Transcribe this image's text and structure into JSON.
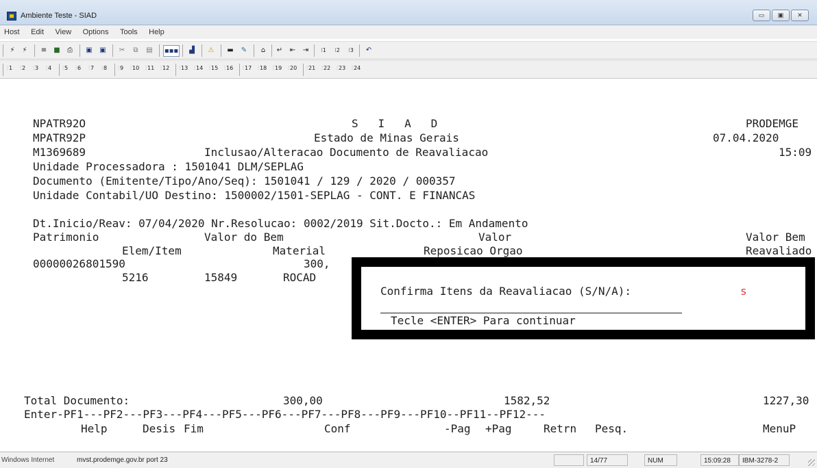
{
  "window": {
    "title": "Ambiente Teste - SIAD",
    "buttons": [
      "▭",
      "▣",
      "✕"
    ]
  },
  "menu": [
    "Host",
    "Edit",
    "View",
    "Options",
    "Tools",
    "Help"
  ],
  "pf_keys": [
    "1",
    "2",
    "3",
    "4",
    "5",
    "6",
    "7",
    "8",
    "9",
    "10",
    "11",
    "12",
    "13",
    "14",
    "15",
    "16",
    "17",
    "18",
    "19",
    "20",
    "21",
    "22",
    "23",
    "24"
  ],
  "screen": {
    "header": {
      "program": "NPATR92O",
      "system": "S   I   A   D",
      "org": "PRODEMGE",
      "map": "MPATR92P",
      "state": "Estado de Minas Gerais",
      "date": "07.04.2020",
      "user": "M1369689",
      "screen_title": "Inclusao/Alteracao Documento de Reavaliacao",
      "time": "15:09"
    },
    "unidade_processadora": "Unidade Processadora : 1501041 DLM/SEPLAG",
    "documento": "Documento (Emitente/Tipo/Ano/Seq): 1501041 / 129 / 2020 / 000357",
    "unidade_contabil": "Unidade Contabil/UO Destino: 1500002/1501-SEPLAG - CONT. E FINANCAS",
    "dt_line": "Dt.Inicio/Reav: 07/04/2020 Nr.Resolucao: 0002/2019 Sit.Docto.: Em Andamento",
    "col_head1": {
      "patrimonio": "Patrimonio",
      "valor_bem": "Valor do Bem",
      "valor": "Valor",
      "valor_bem2": "Valor Bem"
    },
    "col_head2": {
      "elem_item": "Elem/Item",
      "material": "Material",
      "reposicao": "Reposicao Orgao",
      "reavaliado": "Reavaliado"
    },
    "item": {
      "patrimonio": "00000026801590",
      "valor": "300,",
      "elem": "5216",
      "item": "15849",
      "material": "ROCAD"
    },
    "total": {
      "label": "Total Documento:",
      "valor_bem": "300,00",
      "valor": "1582,52",
      "reavaliado": "1227,30"
    },
    "pf_line": "Enter-PF1---PF2---PF3---PF4---PF5---PF6---PF7---PF8---PF9---PF10--PF11--PF12---",
    "pf_labels": {
      "help": "Help",
      "desis": "Desis",
      "fim": "Fim",
      "conf": "Conf",
      "pag_prev": "-Pag",
      "pag_next": "+Pag",
      "retrn": "Retrn",
      "pesq": "Pesq.",
      "menup": "MenuP"
    }
  },
  "popup": {
    "prompt": "Confirma Itens da Reavaliacao (S/N/A):",
    "answer": "s",
    "hint": "Tecle <ENTER> Para continuar"
  },
  "statusbar": {
    "left": "Windows Internet",
    "host": "mvst.prodemge.gov.br port 23",
    "cursor": "14/77",
    "num": "NUM",
    "clock": "15:09:28",
    "model": "IBM-3278-2"
  }
}
